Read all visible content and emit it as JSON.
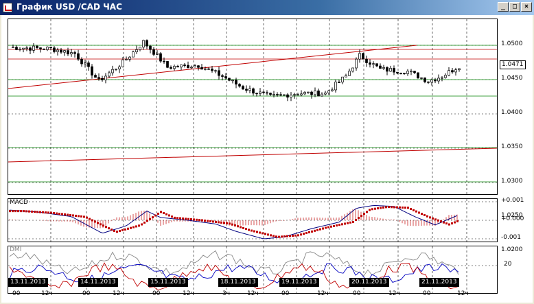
{
  "window": {
    "title": "График USD /CAD  ЧАС",
    "min_glyph": "_",
    "max_glyph": "□",
    "close_glyph": "×"
  },
  "price_axis": {
    "labels": [
      "1.0500",
      "1.0471",
      "1.0450",
      "1.0400",
      "1.0350",
      "1.0300",
      "1.0250",
      "1.0200"
    ],
    "current_price": "1.0471"
  },
  "macd": {
    "label": "MACD",
    "labels": [
      "+0.001",
      "+0.000",
      "-0.001"
    ]
  },
  "dmi": {
    "label": "DMI",
    "labels": [
      "20"
    ]
  },
  "time_axis": {
    "dates": [
      "13.11.2013",
      "14.11.2013",
      "15.11.2013",
      "18.11.2013",
      "19.11.2013",
      "20.11.2013",
      "21.11.2013"
    ],
    "hours": [
      "00",
      "12ч",
      "00",
      "12ч",
      "00",
      "12ч",
      "3ч",
      "12ч",
      "00",
      "12ч",
      "00",
      "12ч",
      "00",
      "12ч"
    ]
  },
  "colors": {
    "candle": "#000000",
    "trend_red": "#c00000",
    "level_green": "#008000",
    "macd_line": "#000080",
    "macd_signal": "#c00000",
    "dmi_plus": "#0000c0",
    "dmi_minus": "#c00000",
    "adx": "#888888"
  }
}
